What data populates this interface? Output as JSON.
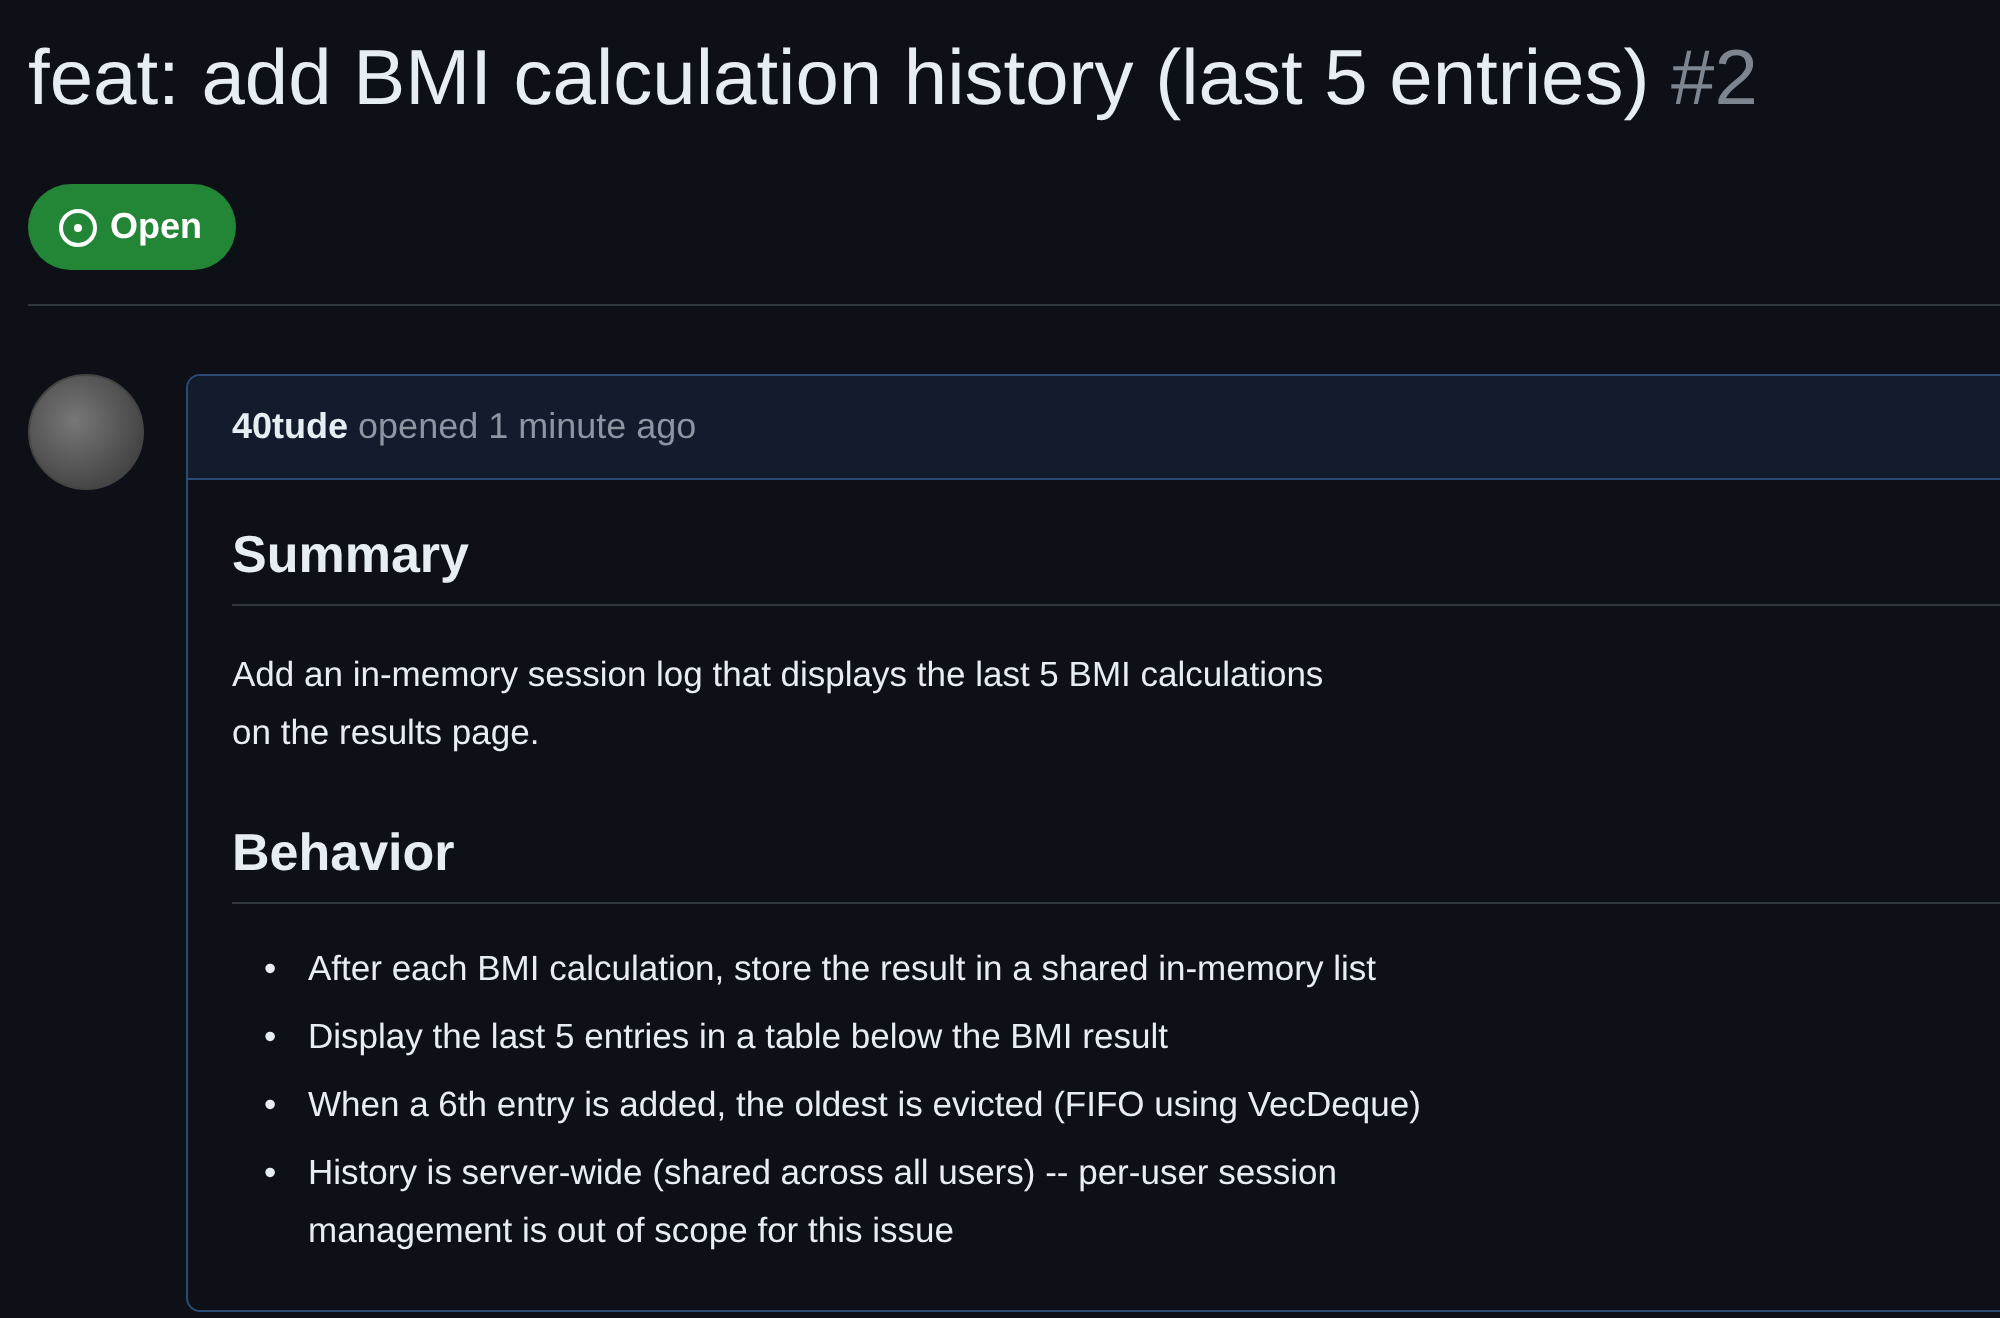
{
  "issue": {
    "title": "feat: add BMI calculation history (last 5 entries)",
    "number": "#2",
    "status": "Open"
  },
  "comment": {
    "author": "40tude",
    "action": "opened 1 minute ago",
    "body": [
      {
        "kind": "heading",
        "text": "Summary"
      },
      {
        "kind": "paragraph",
        "lines": [
          "Add an in-memory session log that displays the last 5 BMI calculations",
          "on the results page."
        ]
      },
      {
        "kind": "heading",
        "text": "Behavior"
      },
      {
        "kind": "list",
        "items": [
          {
            "marker": "•",
            "lines": [
              "After each BMI calculation, store the result in a shared in-memory list"
            ]
          },
          {
            "marker": "•",
            "lines": [
              "Display the last 5 entries in a table below the BMI result"
            ]
          },
          {
            "marker": "•",
            "lines": [
              "When a 6th entry is added, the oldest is evicted (FIFO using VecDeque)"
            ]
          },
          {
            "marker": "•",
            "lines": [
              "History is server-wide (shared across all users) -- per-user session",
              "management is out of scope for this issue"
            ]
          }
        ]
      }
    ]
  }
}
